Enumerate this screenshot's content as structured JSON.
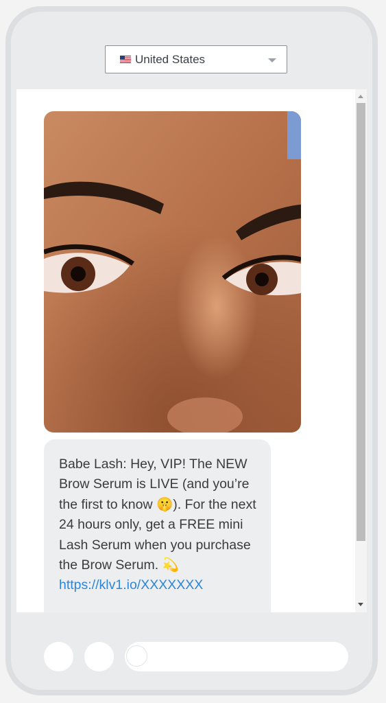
{
  "country_select": {
    "selected": "United States",
    "flag_icon": "us-flag-icon"
  },
  "message": {
    "image_alt": "Close-up of a woman's eyes, brows and lashes",
    "text": "Babe Lash: Hey, VIP! The NEW Brow Serum is LIVE (and you’re the first to know 🤫). For the next 24 hours only, get a FREE mini Lash Serum when you purchase the Brow Serum. 💫",
    "link": "https://klv1.io/XXXXXXX"
  },
  "colors": {
    "phone_frame": "#dcdee1",
    "link": "#2e86d8",
    "bubble": "#eceef0"
  }
}
